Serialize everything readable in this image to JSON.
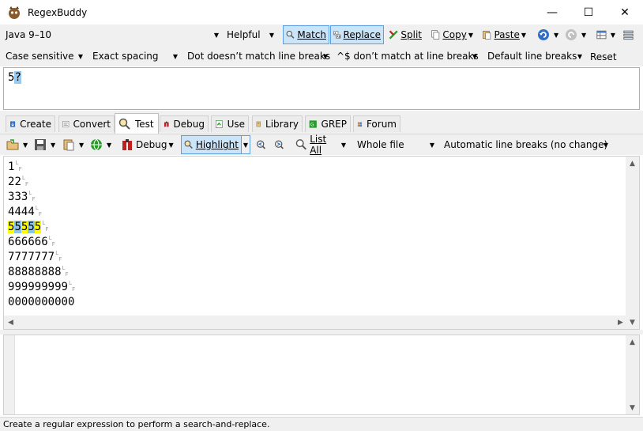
{
  "window": {
    "title": "RegexBuddy",
    "minimize": "—",
    "maximize": "☐",
    "close": "✕"
  },
  "row1": {
    "flavor": "Java 9–10",
    "helpful": "Helpful",
    "match": "Match",
    "replace": "Replace",
    "split": "Split",
    "copy": "Copy",
    "paste": "Paste"
  },
  "row2": {
    "case": "Case sensitive",
    "spacing": "Exact spacing",
    "dot": "Dot doesn’t match line breaks",
    "anchors": "^$ don’t match at line breaks",
    "linebreaks": "Default line breaks",
    "reset": "Reset"
  },
  "regex": {
    "plain": "5",
    "selected": "?"
  },
  "tabs": [
    "Create",
    "Convert",
    "Test",
    "Debug",
    "Use",
    "Library",
    "GREP",
    "Forum"
  ],
  "row3": {
    "debug": "Debug",
    "highlight": "Highlight",
    "listall": "List All",
    "scope": "Whole file",
    "linebreaks": "Automatic line breaks (no change)"
  },
  "test_lines": [
    "1",
    "22",
    "333",
    "4444",
    "55555",
    "666666",
    "7777777",
    "88888888",
    "999999999",
    "0000000000"
  ],
  "lf_marker": {
    "top": "L",
    "bottom": "F"
  },
  "status": "Create a regular expression to perform a search-and-replace."
}
